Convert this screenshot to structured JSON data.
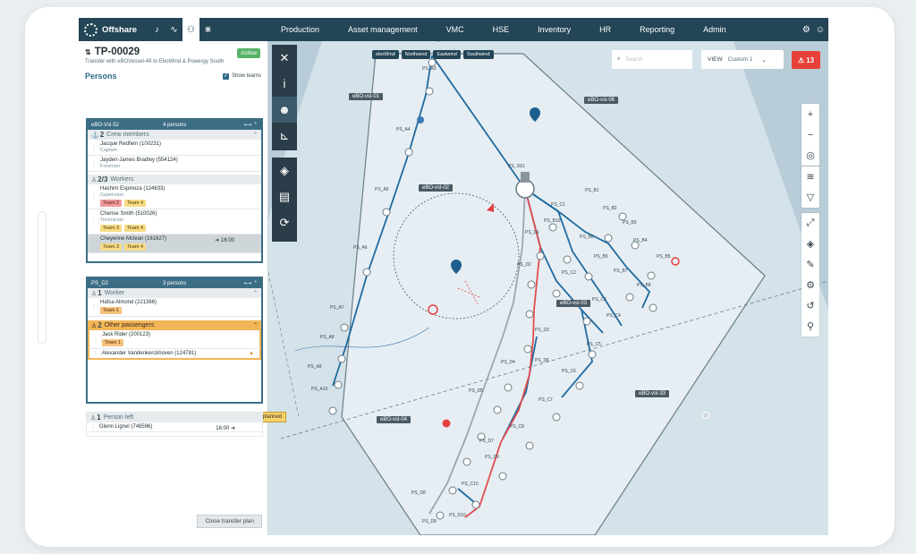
{
  "app": {
    "name": "Offshare"
  },
  "nav": {
    "menu": [
      "Production",
      "Asset management",
      "VMC",
      "HSE",
      "Inventory",
      "HR",
      "Reporting",
      "Admin"
    ]
  },
  "transfer": {
    "id": "TP-00029",
    "status": "Active",
    "subtitle": "Transfer with eBOVessel-49 to EboWind & Powergy South",
    "persons_label": "Persons",
    "show_teams_label": "Show teams",
    "close_button": "Close transfer plan",
    "unplanned_tooltip": "Unplanned"
  },
  "vessels": [
    {
      "name": "eBO-Vsl-52",
      "count": "4 persons",
      "groups": [
        {
          "count": "2",
          "label": "Crew members",
          "people": [
            {
              "name": "Jacque Redfern (100231)",
              "role": "Captain"
            },
            {
              "name": "Jayden-James Bradley (554124)",
              "role": "Foreman"
            }
          ]
        },
        {
          "count": "2/3",
          "label": "Workers",
          "people": [
            {
              "name": "Hashim Espinoza (124633)",
              "role": "Supervisor",
              "tags": [
                "Team 2",
                "Team 4"
              ]
            },
            {
              "name": "Cherise Smith (510026)",
              "role": "Technician",
              "tags": [
                "Team 3",
                "Team 4"
              ]
            },
            {
              "name": "Cheyenne Mclean (161627)",
              "eta": "16:00",
              "tags": [
                "Team 3",
                "Team 4"
              ]
            }
          ]
        }
      ]
    },
    {
      "name": "PS_D2",
      "count": "3 persons",
      "groups": [
        {
          "count": "1",
          "label": "Worker",
          "people": [
            {
              "name": "Hafsa Almond (221366)",
              "tags": [
                "Team 1"
              ]
            }
          ]
        },
        {
          "count": "2",
          "label": "Other passengers",
          "people": [
            {
              "name": "Jack Rider (200123)",
              "tags": [
                "Team 1"
              ]
            },
            {
              "name": "Alexander Vandenkerckhoven (124781)"
            }
          ]
        }
      ]
    }
  ],
  "person_left": {
    "count": "1",
    "label": "Person left",
    "name": "Glenn Lignel (748596)",
    "eta": "16:00"
  },
  "map": {
    "chips": [
      "eboWind",
      "Northwind",
      "Eastwind",
      "Southwind"
    ],
    "search_placeholder": "Search",
    "view_label": "VIEW",
    "view_value": "Custom 1",
    "alarm_count": "13",
    "vessel_labels": [
      "eBO-vsl-01",
      "eBO-vsl-02",
      "eBO-vsl-03",
      "eBO-vsl-04",
      "eBO-vsl-06",
      "eBO-vsl-33"
    ],
    "ps_labels": [
      "PS_A2",
      "PS_A3",
      "PS_A4",
      "PS_A5",
      "PS_A6",
      "PS_A7",
      "PS_A8",
      "PS_A9",
      "PS_A10",
      "PS_SS1",
      "PS_B1",
      "PS_B2",
      "PS_B3",
      "PS_B4",
      "PS_B5",
      "PS_B6",
      "PS_B7",
      "PS_B8",
      "PS_B9",
      "PS_B10",
      "PS_C1",
      "PS_C2",
      "PS_C3",
      "PS_C4",
      "PS_C5",
      "PS_C6",
      "PS_C7",
      "PS_C8",
      "PS_C9",
      "PS_C10",
      "PS_D1",
      "PS_D2",
      "PS_D3",
      "PS_D4",
      "PS_D5",
      "PS_D6",
      "PS_D7",
      "PS_D8",
      "PS_D9",
      "PS_D10"
    ]
  }
}
